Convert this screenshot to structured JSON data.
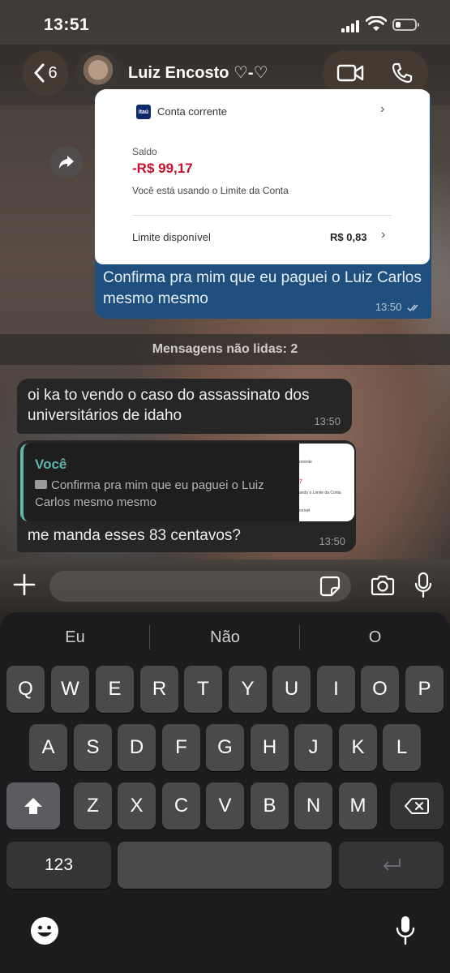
{
  "status_bar": {
    "time": "13:51"
  },
  "header": {
    "back_count": "6",
    "contact_name": "Luiz Encosto ♡-♡"
  },
  "messages": {
    "outgoing_image": {
      "bank": {
        "logo_text": "itaú",
        "account_label": "Conta corrente",
        "saldo_label": "Saldo",
        "saldo_value": "-R$ 99,17",
        "saldo_note": "Você está usando o Limite da Conta",
        "limite_label": "Limite disponível",
        "limite_value": "R$ 0,83"
      },
      "caption": "Confirma pra mim que eu paguei o Luiz Carlos mesmo mesmo",
      "time": "13:50",
      "status_color": "#b9c8d8"
    },
    "unread_banner": "Mensagens não lidas: 2",
    "incoming_1": {
      "text": "oi ka to vendo o caso do assassinato dos universitários de idaho",
      "time": "13:50"
    },
    "incoming_2": {
      "reply_author": "Você",
      "reply_text": "Confirma pra mim que eu paguei o Luiz Carlos mesmo mesmo",
      "reply_thumb_lines": [
        "orrente",
        "7",
        "ando o Limite da Conta",
        "onível"
      ],
      "text": "me manda esses 83 centavos?",
      "time": "13:50"
    }
  },
  "composer": {
    "value": "",
    "placeholder": ""
  },
  "keyboard": {
    "suggestions": [
      "Eu",
      "Não",
      "O"
    ],
    "row1": [
      "Q",
      "W",
      "E",
      "R",
      "T",
      "Y",
      "U",
      "I",
      "O",
      "P"
    ],
    "row2": [
      "A",
      "S",
      "D",
      "F",
      "G",
      "H",
      "J",
      "K",
      "L"
    ],
    "row3": [
      "Z",
      "X",
      "C",
      "V",
      "B",
      "N",
      "M"
    ],
    "numbers_key": "123",
    "space_key": "",
    "return_key": ""
  },
  "colors": {
    "outgoing_bubble": "#1f4f7d",
    "incoming_bubble": "#262626",
    "reply_accent": "#5eb6a9",
    "negative_balance": "#c8102e"
  },
  "icons": [
    "back-chevron-icon",
    "video-call-icon",
    "phone-icon",
    "forward-icon",
    "camera-small-icon",
    "read-receipt-icon",
    "plus-icon",
    "sticker-icon",
    "camera-icon",
    "microphone-icon",
    "shift-icon",
    "backspace-icon",
    "return-icon",
    "emoji-icon",
    "dictation-icon"
  ]
}
